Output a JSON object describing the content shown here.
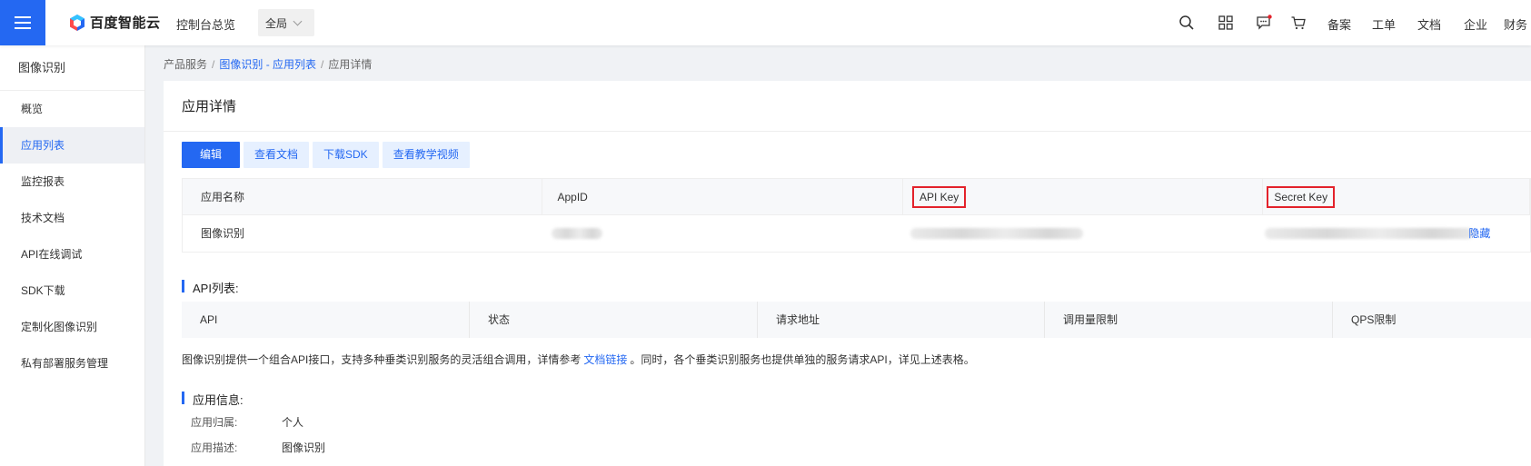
{
  "topbar": {
    "brand": "百度智能云",
    "console_label": "控制台总览",
    "region_value": "全局",
    "nav_items": [
      "备案",
      "工单",
      "文档",
      "企业",
      "财务"
    ]
  },
  "sidebar": {
    "title": "图像识别",
    "items": [
      {
        "label": "概览"
      },
      {
        "label": "应用列表"
      },
      {
        "label": "监控报表"
      },
      {
        "label": "技术文档"
      },
      {
        "label": "API在线调试"
      },
      {
        "label": "SDK下载"
      },
      {
        "label": "定制化图像识别"
      },
      {
        "label": "私有部署服务管理"
      }
    ],
    "active_index": 1
  },
  "breadcrumb": {
    "root": "产品服务",
    "link": "图像识别 - 应用列表",
    "current": "应用详情"
  },
  "panel": {
    "title": "应用详情",
    "buttons": {
      "edit": "编辑",
      "docs": "查看文档",
      "sdk": "下载SDK",
      "videos": "查看教学视频"
    },
    "info_table": {
      "headers": [
        "应用名称",
        "AppID",
        "API Key",
        "Secret Key"
      ],
      "row": {
        "app_name": "图像识别",
        "hide_link": "隐藏"
      }
    },
    "api_section": {
      "title": "API列表:",
      "headers": [
        "API",
        "状态",
        "请求地址",
        "调用量限制",
        "QPS限制"
      ]
    },
    "description": {
      "before": "图像识别提供一个组合API接口，支持多种垂类识别服务的灵活组合调用，详情参考",
      "link": "文档链接",
      "after": "。同时，各个垂类识别服务也提供单独的服务请求API，详见上述表格。"
    },
    "app_info": {
      "title": "应用信息:",
      "owner_label": "应用归属:",
      "owner_value": "个人",
      "desc_label": "应用描述:",
      "desc_value": "图像识别"
    }
  },
  "colors": {
    "accent": "#2468f2",
    "highlight_box": "#e3222b"
  }
}
